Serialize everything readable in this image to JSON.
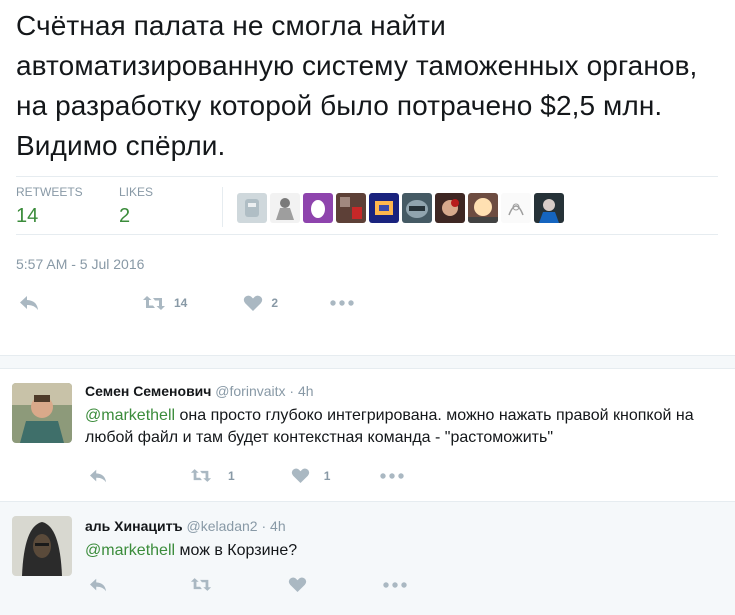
{
  "tweet": {
    "text": "Счётная палата не смогла найти автоматизированную систему таможенных органов, на разработку которой было потрачено $2,5 млн. Видимо спёрли.",
    "stats": {
      "retweets_label": "RETWEETS",
      "retweets_value": "14",
      "likes_label": "LIKES",
      "likes_value": "2"
    },
    "likers": [
      "avatar-1",
      "avatar-2",
      "avatar-3",
      "avatar-4",
      "avatar-5",
      "avatar-6",
      "avatar-7",
      "avatar-8",
      "avatar-9",
      "avatar-10"
    ],
    "timestamp": "5:57 AM - 5 Jul 2016",
    "actions": {
      "retweet_count": "14",
      "like_count": "2"
    }
  },
  "replies": [
    {
      "name": "Семен Семенович",
      "handle": "@forinvaitx",
      "sep": "·",
      "time": "4h",
      "mention": "@markethell",
      "text": " она просто глубоко интегрирована. можно нажать правой кнопкой на любой файл и там будет контекстная команда - \"растоможить\"",
      "retweet_count": "1",
      "like_count": "1"
    },
    {
      "name": "аль Хинацитъ",
      "handle": "@keladan2",
      "sep": "·",
      "time": "4h",
      "mention": "@markethell",
      "text": " мож в Корзине?"
    }
  ],
  "colors": {
    "link": "#3b8c3b",
    "muted": "#8899a6",
    "icon": "#aab8c2",
    "band": "#f5f8fa"
  },
  "icons": [
    "reply-icon",
    "retweet-icon",
    "heart-icon",
    "more-icon"
  ]
}
